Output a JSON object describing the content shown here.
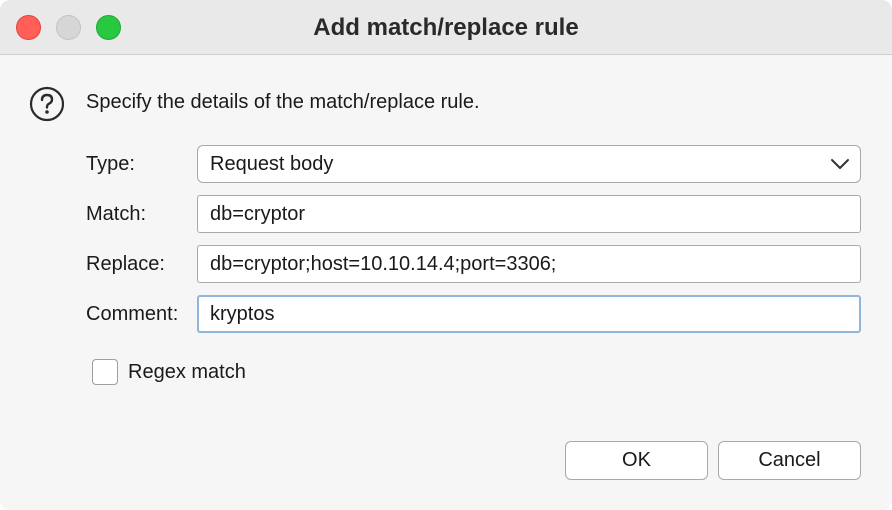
{
  "window": {
    "title": "Add match/replace rule"
  },
  "dialog": {
    "instruction": "Specify the details of the match/replace rule.",
    "help_icon": "question-circle-icon"
  },
  "form": {
    "type_label": "Type:",
    "type_value": "Request body",
    "match_label": "Match:",
    "match_value": "db=cryptor",
    "replace_label": "Replace:",
    "replace_value": "db=cryptor;host=10.10.14.4;port=3306;",
    "comment_label": "Comment:",
    "comment_value": "kryptos",
    "regex_label": "Regex match",
    "regex_checked": false
  },
  "buttons": {
    "ok": "OK",
    "cancel": "Cancel"
  },
  "colors": {
    "close": "#ff5f57",
    "minimize": "#d6d6d6",
    "zoom": "#28c840",
    "focus_ring": "#8fb7dc"
  }
}
